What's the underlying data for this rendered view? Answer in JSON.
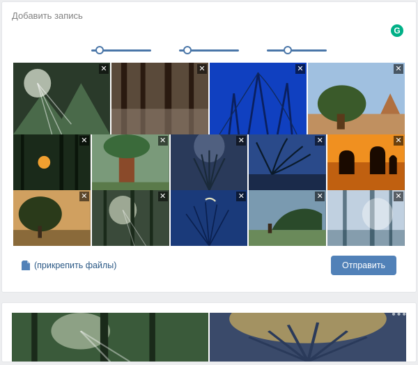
{
  "composer": {
    "placeholder": "Добавить запись",
    "grammarly_badge": "G"
  },
  "sliders": [
    {
      "name": "slider-1"
    },
    {
      "name": "slider-2"
    },
    {
      "name": "slider-3"
    }
  ],
  "thumbs_close_label": "✕",
  "footer": {
    "attach_label": "(прикрепить файлы)",
    "send_label": "Отправить"
  },
  "feed": {
    "menu_label": "•••"
  }
}
